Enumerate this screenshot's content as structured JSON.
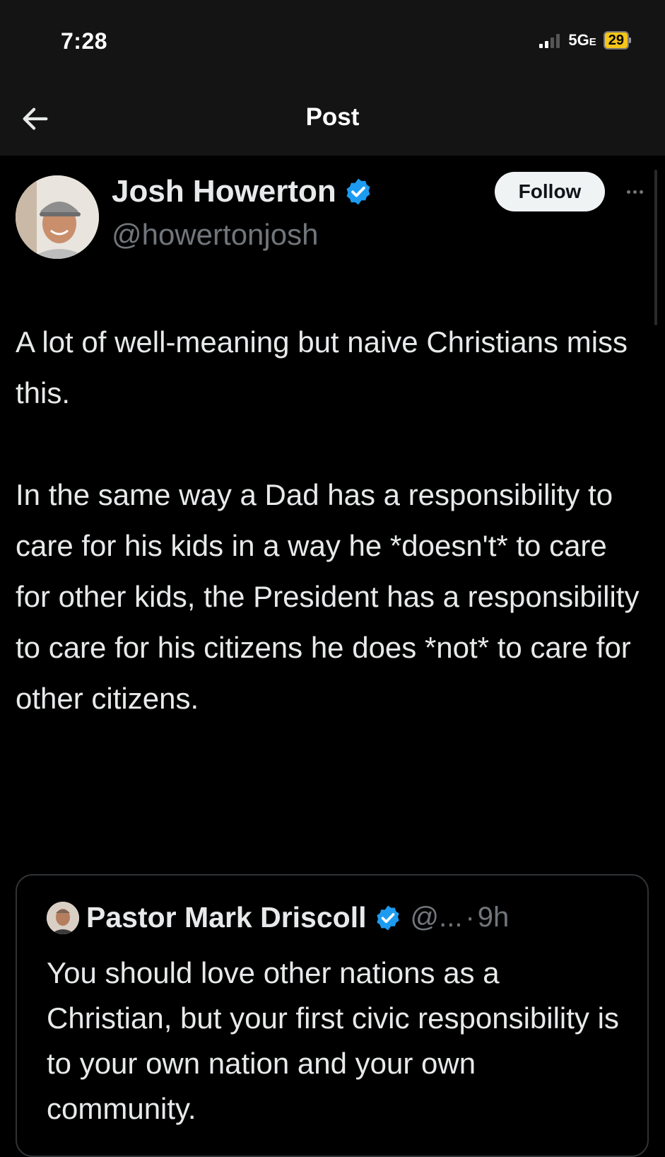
{
  "status_bar": {
    "time": "7:28",
    "network": "5G",
    "network_suffix": "E",
    "battery": "29"
  },
  "nav": {
    "back_icon": "arrow-left-icon",
    "title": "Post"
  },
  "post": {
    "author": {
      "name": "Josh Howerton",
      "handle": "@howertonjosh",
      "verified": true
    },
    "follow_label": "Follow",
    "more_icon": "more-horizontal-icon",
    "paragraphs": [
      "A lot of well-meaning but naive Christians miss this.",
      "In the same way a Dad has a responsibility to care for his kids in a way he *doesn't* to care for other kids, the President has a responsibility to care for his citizens he does *not* to care for other citizens."
    ]
  },
  "quote": {
    "author_name": "Pastor Mark Driscoll",
    "handle": "@...",
    "separator": "·",
    "time": "9h",
    "verified": true,
    "text": "You should love other nations as a Christian, but your first civic responsibility is to your own nation and your own community."
  },
  "colors": {
    "background": "#000000",
    "header_background": "#141414",
    "text_primary": "#e7e9ea",
    "text_secondary": "#71767b",
    "verified_blue": "#1d9bf0",
    "battery_yellow": "#f5c518",
    "border": "#2f3336"
  }
}
